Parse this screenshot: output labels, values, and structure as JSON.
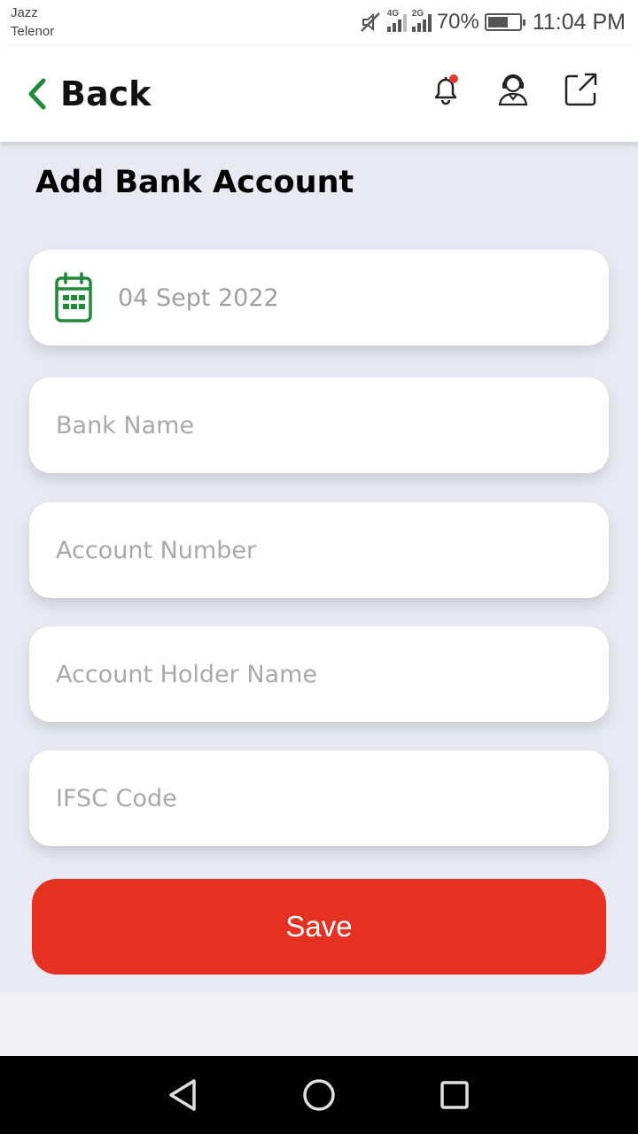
{
  "status_bar": {
    "carrier1": "Jazz",
    "carrier2": "Telenor",
    "network1": "4G",
    "network2": "2G",
    "battery_percent": "70%",
    "battery_level": 0.7,
    "time": "11:04 PM",
    "icons": [
      "mute-icon",
      "signal-4g-icon",
      "signal-2g-icon",
      "battery-icon"
    ]
  },
  "header": {
    "back_label": "Back",
    "icons": [
      "notification-bell-icon",
      "support-agent-icon",
      "external-link-icon"
    ],
    "notification_dot_color": "#e53935"
  },
  "page": {
    "title": "Add Bank Account",
    "date_value": "04 Sept 2022",
    "fields": {
      "bank_name_placeholder": "Bank Name",
      "account_number_placeholder": "Account Number",
      "account_holder_placeholder": "Account Holder Name",
      "ifsc_placeholder": "IFSC Code"
    },
    "save_label": "Save"
  },
  "colors": {
    "accent_green": "#1e8a3a",
    "save_red": "#e43121",
    "background": "#e9e9f3"
  },
  "nav_bar": {
    "icons": [
      "back-triangle-icon",
      "home-circle-icon",
      "recents-square-icon"
    ]
  }
}
